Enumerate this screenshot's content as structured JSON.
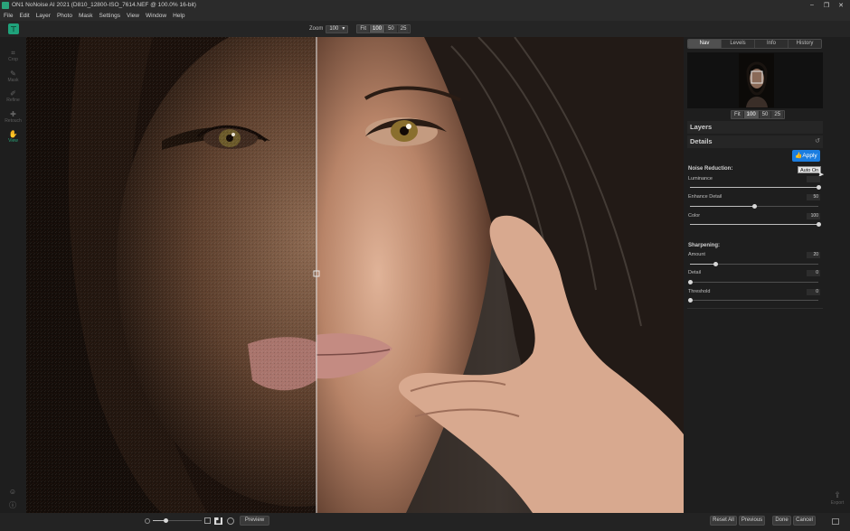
{
  "window": {
    "title": "ON1 NoNoise AI 2021 (D810_12800-ISO_7614.NEF @ 100.0% 16-bit)",
    "controls": [
      "–",
      "❐",
      "✕"
    ]
  },
  "menu": [
    "File",
    "Edit",
    "Layer",
    "Photo",
    "Mask",
    "Settings",
    "View",
    "Window",
    "Help"
  ],
  "toolbar": {
    "zoom_label": "Zoom",
    "zoom_value": "100",
    "zoom_presets": [
      "Fit",
      "100",
      "50",
      "25"
    ]
  },
  "left_tools": [
    {
      "label": "Crop",
      "icon": "crop-icon"
    },
    {
      "label": "Mask",
      "icon": "brush-icon"
    },
    {
      "label": "Refine",
      "icon": "refine-brush-icon"
    },
    {
      "label": "Retouch",
      "icon": "retouch-icon"
    },
    {
      "label": "View",
      "icon": "hand-icon"
    }
  ],
  "right_panel": {
    "tabs": [
      "Nav",
      "Levels",
      "Info",
      "History"
    ],
    "active_tab": "Nav",
    "nav_zoom": [
      "Fit",
      "100",
      "50",
      "25"
    ],
    "layers_label": "Layers",
    "details_label": "Details",
    "apply_label": "Apply",
    "auto_tooltip": "Auto On",
    "noise_reduction_label": "Noise Reduction:",
    "sharpening_label": "Sharpening:",
    "sliders": [
      {
        "label": "Luminance",
        "value": "",
        "fraction": 1.0
      },
      {
        "label": "Enhance Detail",
        "value": "50",
        "fraction": 0.5
      },
      {
        "label": "Color",
        "value": "100",
        "fraction": 1.0
      },
      {
        "label": "Amount",
        "value": "20",
        "fraction": 0.2
      },
      {
        "label": "Detail",
        "value": "0",
        "fraction": 0.0
      },
      {
        "label": "Threshold",
        "value": "0",
        "fraction": 0.0
      }
    ]
  },
  "bottom": {
    "preview_label": "Preview",
    "reset_all": "Reset All",
    "previous": "Previous",
    "done": "Done",
    "cancel": "Cancel",
    "export_label": "Export"
  },
  "colors": {
    "accent": "#2aa37a",
    "apply_blue": "#1b7de0"
  }
}
